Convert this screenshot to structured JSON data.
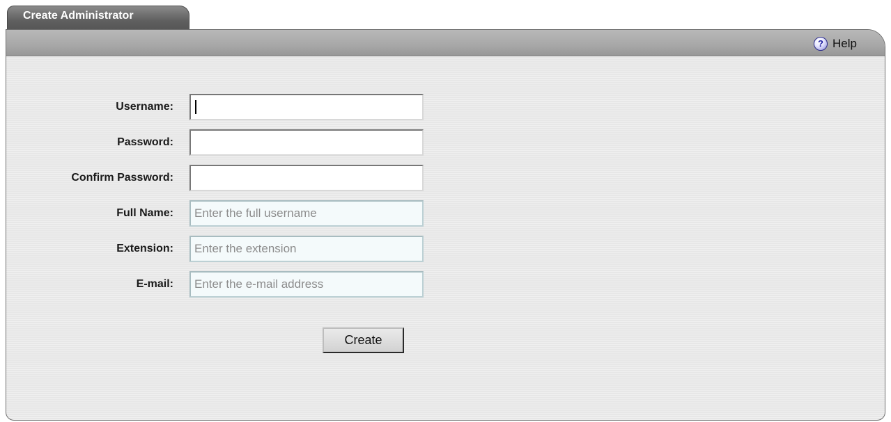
{
  "tab": {
    "title": "Create Administrator"
  },
  "header": {
    "help_label": "Help",
    "help_icon": "help-icon"
  },
  "form": {
    "fields": [
      {
        "label": "Username:",
        "value": "",
        "placeholder": ""
      },
      {
        "label": "Password:",
        "value": "",
        "placeholder": ""
      },
      {
        "label": "Confirm Password:",
        "value": "",
        "placeholder": ""
      },
      {
        "label": "Full Name:",
        "value": "",
        "placeholder": "Enter the full username"
      },
      {
        "label": "Extension:",
        "value": "",
        "placeholder": "Enter the extension"
      },
      {
        "label": "E-mail:",
        "value": "",
        "placeholder": "Enter the e-mail address"
      }
    ],
    "submit_label": "Create"
  },
  "colors": {
    "tab_background": "#5f5f5f",
    "panel_background": "#e7e7e7",
    "header_bar": "#a9a9a9",
    "optional_field_background": "#f4fafb"
  }
}
